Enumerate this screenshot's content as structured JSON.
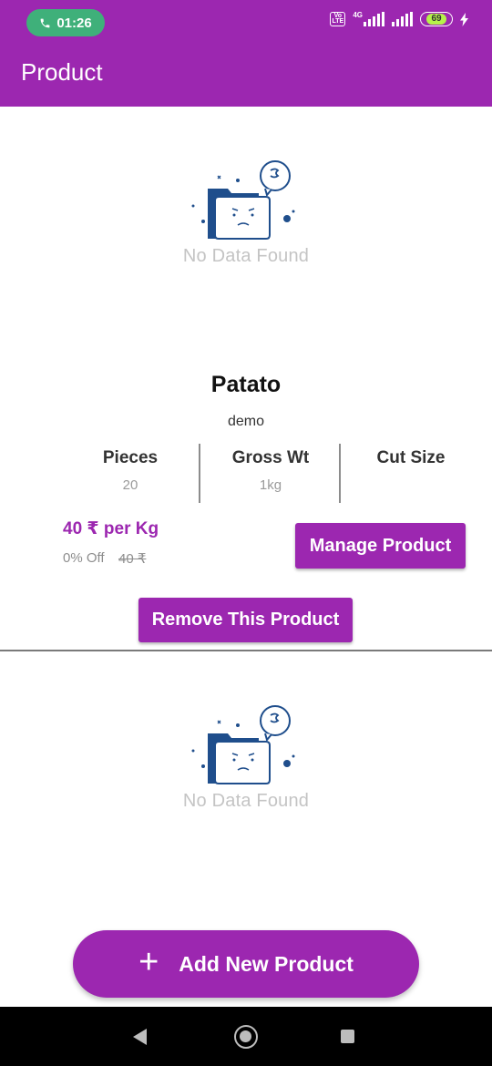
{
  "status_bar": {
    "time": "01:26",
    "volte_label": "Vo LTE",
    "network_label": "4G",
    "battery": "69"
  },
  "appbar": {
    "title": "Product"
  },
  "empty_state_top": {
    "text": "No Data Found"
  },
  "product": {
    "name": "Patato",
    "description": "demo",
    "specs": [
      {
        "label": "Pieces",
        "value": "20"
      },
      {
        "label": "Gross Wt",
        "value": "1kg"
      },
      {
        "label": "Cut Size",
        "value": ""
      }
    ],
    "price": "40 ₹ per Kg",
    "discount": "0% Off",
    "original_price": "40 ₹",
    "manage_label": "Manage Product",
    "remove_label": "Remove This Product"
  },
  "empty_state_bottom": {
    "text": "No Data Found"
  },
  "fab": {
    "icon": "plus-icon",
    "label": "Add New Product"
  },
  "colors": {
    "primary": "#9c27b0",
    "call_pill": "#3fb07a",
    "empty_text": "#c4c4c4"
  }
}
